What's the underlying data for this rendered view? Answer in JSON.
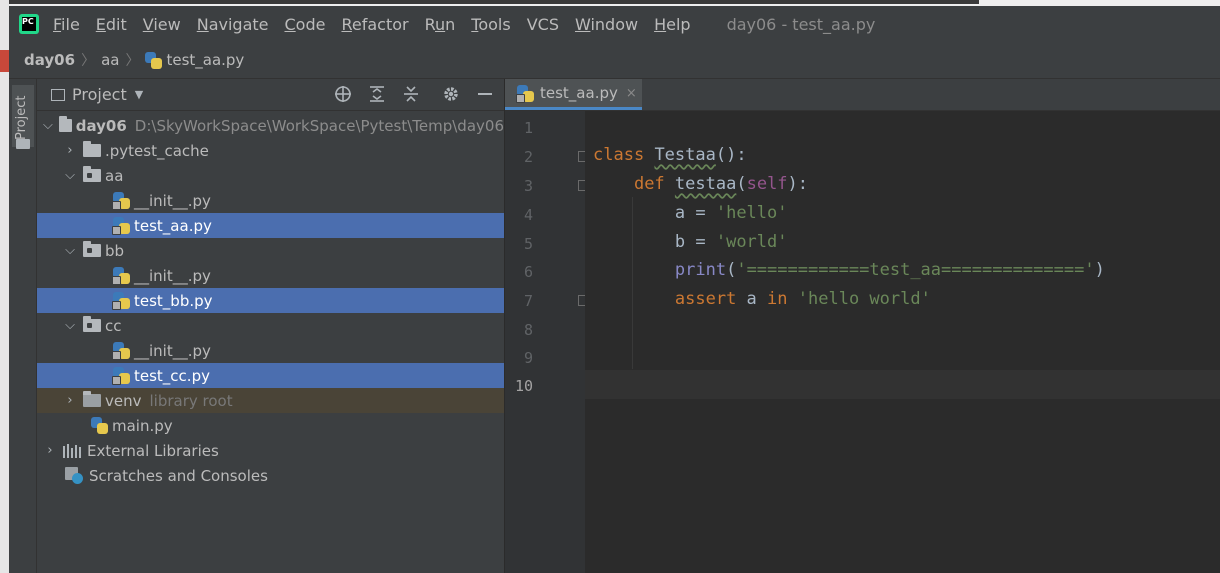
{
  "window_title": "day06 - test_aa.py",
  "menu": [
    {
      "mnemonic": "F",
      "rest": "ile"
    },
    {
      "mnemonic": "E",
      "rest": "dit"
    },
    {
      "mnemonic": "V",
      "rest": "iew"
    },
    {
      "mnemonic": "N",
      "rest": "avigate"
    },
    {
      "mnemonic": "C",
      "rest": "ode"
    },
    {
      "mnemonic": "R",
      "rest": "efactor"
    },
    {
      "pre": "R",
      "mnemonic": "u",
      "rest": "n"
    },
    {
      "mnemonic": "T",
      "rest": "ools"
    },
    {
      "pre": "VC",
      "mnemonic": "S",
      "rest": ""
    },
    {
      "mnemonic": "W",
      "rest": "indow"
    },
    {
      "mnemonic": "H",
      "rest": "elp"
    }
  ],
  "logo_text": "PC",
  "breadcrumb": [
    "day06",
    "aa",
    "test_aa.py"
  ],
  "tool_strip_label": "Project",
  "project_panel": {
    "title": "Project",
    "dropdown": "▼"
  },
  "tree": {
    "root": {
      "name": "day06",
      "path": "D:\\SkyWorkSpace\\WorkSpace\\Pytest\\Temp\\day06"
    },
    "pytest_cache": ".pytest_cache",
    "aa": {
      "name": "aa",
      "init": "__init__.py",
      "test": "test_aa.py"
    },
    "bb": {
      "name": "bb",
      "init": "__init__.py",
      "test": "test_bb.py"
    },
    "cc": {
      "name": "cc",
      "init": "__init__.py",
      "test": "test_cc.py"
    },
    "venv": {
      "name": "venv",
      "hint": "library root"
    },
    "main": "main.py",
    "external_libraries": "External Libraries",
    "scratches": "Scratches and Consoles"
  },
  "editor": {
    "tab_label": "test_aa.py",
    "tab_close": "×",
    "line_numbers": [
      "1",
      "2",
      "3",
      "4",
      "5",
      "6",
      "7",
      "8",
      "9",
      "10"
    ],
    "current_line": "10",
    "code": {
      "l2_kw": "class",
      "l2_name": "Testaa",
      "l2_rest": "():",
      "l3_kw": "def",
      "l3_name": "testaa",
      "l3_open": "(",
      "l3_self": "self",
      "l3_close": "):",
      "l4_var": "a = ",
      "l4_str": "'hello'",
      "l5_var": "b = ",
      "l5_str": "'world'",
      "l6_fn": "print",
      "l6_open": "(",
      "l6_str": "'============test_aa=============='",
      "l6_close": ")",
      "l7_kw": "assert",
      "l7_var": " a ",
      "l7_in": "in",
      "l7_str": "'hello world'"
    }
  }
}
